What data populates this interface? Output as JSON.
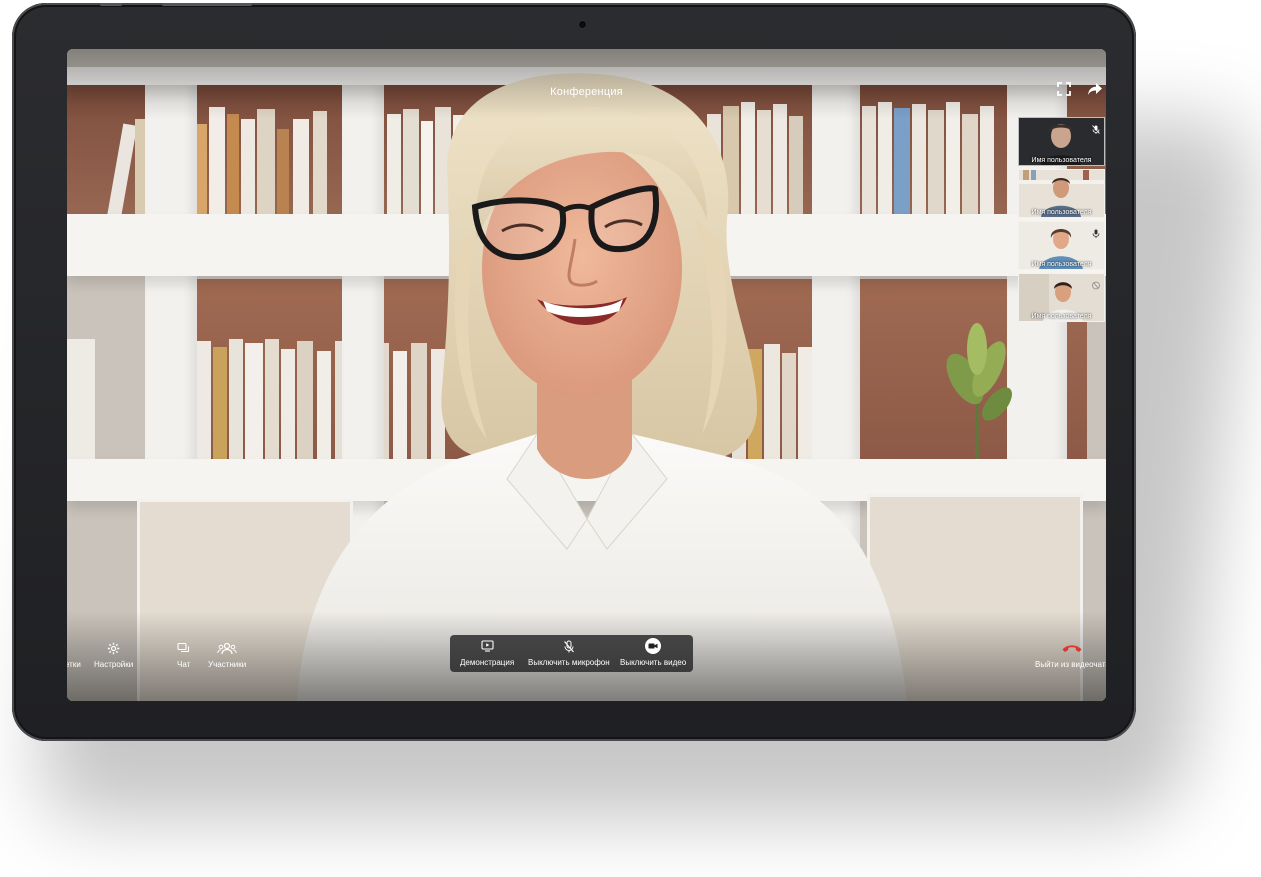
{
  "window": {
    "title": "Конференция"
  },
  "participants": [
    {
      "name": "Имя пользователя",
      "mic_icon": "mic-off-icon"
    },
    {
      "name": "Имя пользователя",
      "mic_icon": ""
    },
    {
      "name": "Имя пользователя",
      "mic_icon": "mic-icon"
    },
    {
      "name": "Имя пользователя",
      "mic_icon": "mic-off-icon"
    }
  ],
  "toolbar": {
    "left": [
      {
        "label": "етки",
        "icon": "grid-icon"
      },
      {
        "label": "Настройки",
        "icon": "gear-icon"
      },
      {
        "label": "Чат",
        "icon": "chat-icon"
      },
      {
        "label": "Участники",
        "icon": "people-icon"
      }
    ],
    "center": [
      {
        "label": "Демонстрация",
        "icon": "screen-share-icon"
      },
      {
        "label": "Выключить микрофон",
        "icon": "mic-off-icon"
      },
      {
        "label": "Выключить видео",
        "icon": "video-icon"
      }
    ],
    "leave": {
      "label": "Выйти из видеочата",
      "icon": "hang-up-icon",
      "color": "#e0332f"
    }
  },
  "top_actions": [
    {
      "icon": "fullscreen-icon"
    },
    {
      "icon": "share-icon"
    }
  ]
}
